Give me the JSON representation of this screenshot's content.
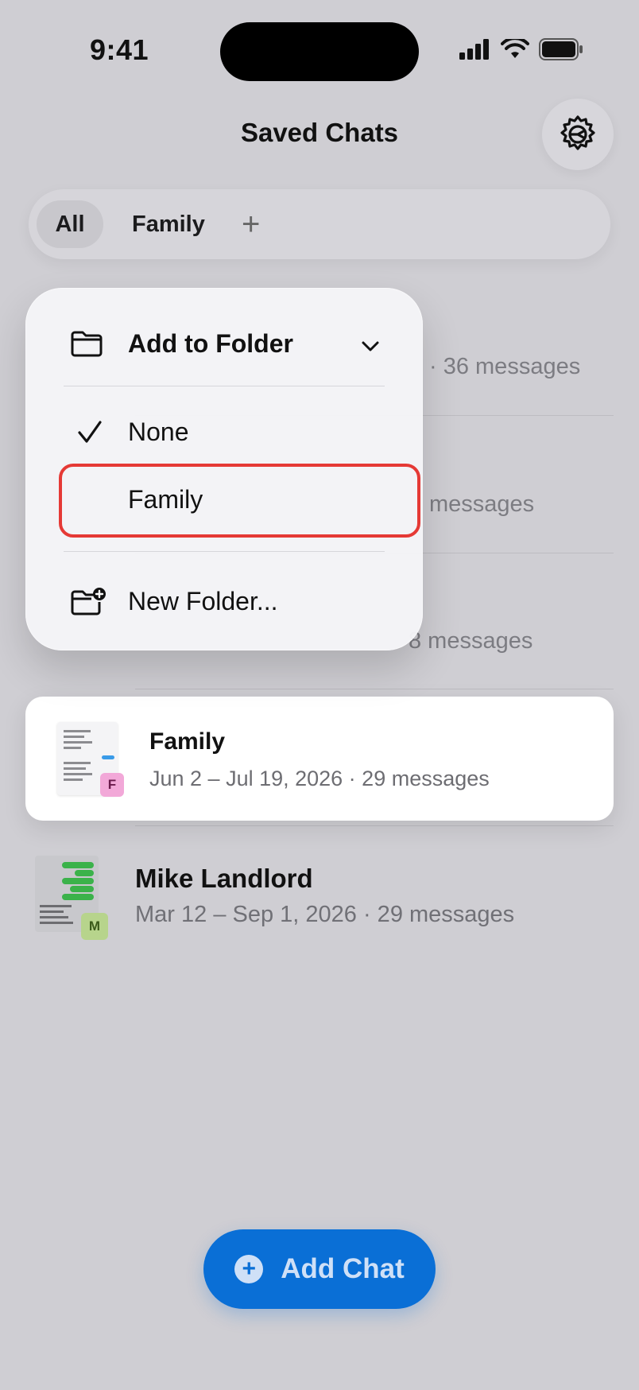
{
  "status_bar": {
    "time": "9:41"
  },
  "header": {
    "title": "Saved Chats"
  },
  "tabs": [
    {
      "label": "All",
      "selected": true
    },
    {
      "label": "Family",
      "selected": false
    },
    {
      "label": "+"
    }
  ],
  "background_rows": [
    {
      "meta_fragment": "· 36 messages"
    },
    {
      "meta_fragment": "messages"
    },
    {
      "meta_fragment": "8 messages"
    }
  ],
  "menu": {
    "header": "Add to Folder",
    "options": [
      {
        "label": "None",
        "checked": true
      },
      {
        "label": "Family",
        "checked": false,
        "highlighted": true
      }
    ],
    "new_folder": "New Folder..."
  },
  "chats": [
    {
      "name": "Family",
      "dates": "Jun 2 – Jul 19, 2026 · 29 messages",
      "badge": "F",
      "badge_color": "#f2a8d8"
    },
    {
      "name": "Mike Landlord",
      "dates": "Mar 12 – Sep 1, 2026 · 29 messages",
      "badge": "M",
      "badge_color": "#b7d48c"
    }
  ],
  "add_button": {
    "label": "Add Chat"
  },
  "colors": {
    "accent": "#0a6fd6",
    "highlight_border": "#e53935"
  }
}
